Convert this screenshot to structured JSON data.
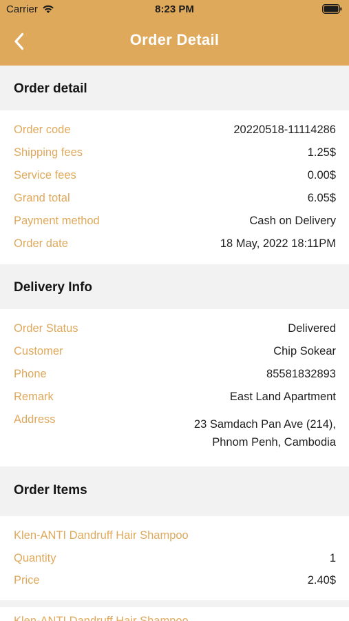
{
  "status_bar": {
    "carrier": "Carrier",
    "time": "8:23 PM"
  },
  "nav": {
    "title": "Order Detail",
    "back_icon": "chevron-left-icon"
  },
  "colors": {
    "accent": "#dfa95c",
    "section_bg": "#f2f2f2",
    "title_text": "#ffffff"
  },
  "order_detail": {
    "title": "Order detail",
    "rows": [
      {
        "label": "Order code",
        "value": "20220518-11114286"
      },
      {
        "label": "Shipping fees",
        "value": "1.25$"
      },
      {
        "label": "Service fees",
        "value": "0.00$"
      },
      {
        "label": "Grand total",
        "value": "6.05$"
      },
      {
        "label": "Payment method",
        "value": "Cash on Delivery"
      },
      {
        "label": "Order date",
        "value": "18 May, 2022 18:11PM"
      }
    ]
  },
  "delivery_info": {
    "title": "Delivery Info",
    "rows": [
      {
        "label": "Order Status",
        "value": "Delivered"
      },
      {
        "label": "Customer",
        "value": "Chip Sokear"
      },
      {
        "label": "Phone",
        "value": "85581832893"
      },
      {
        "label": "Remark",
        "value": "East Land Apartment"
      }
    ],
    "address": {
      "label": "Address",
      "line1": "23 Samdach Pan Ave (214),",
      "line2": "Phnom Penh, Cambodia"
    }
  },
  "order_items": {
    "title": "Order Items",
    "items": [
      {
        "name": "Klen-ANTI Dandruff Hair Shampoo",
        "quantity_label": "Quantity",
        "quantity": "1",
        "price_label": "Price",
        "price": "2.40$"
      },
      {
        "name": "Klen-ANTI Dandruff Hair Shampoo"
      }
    ]
  }
}
